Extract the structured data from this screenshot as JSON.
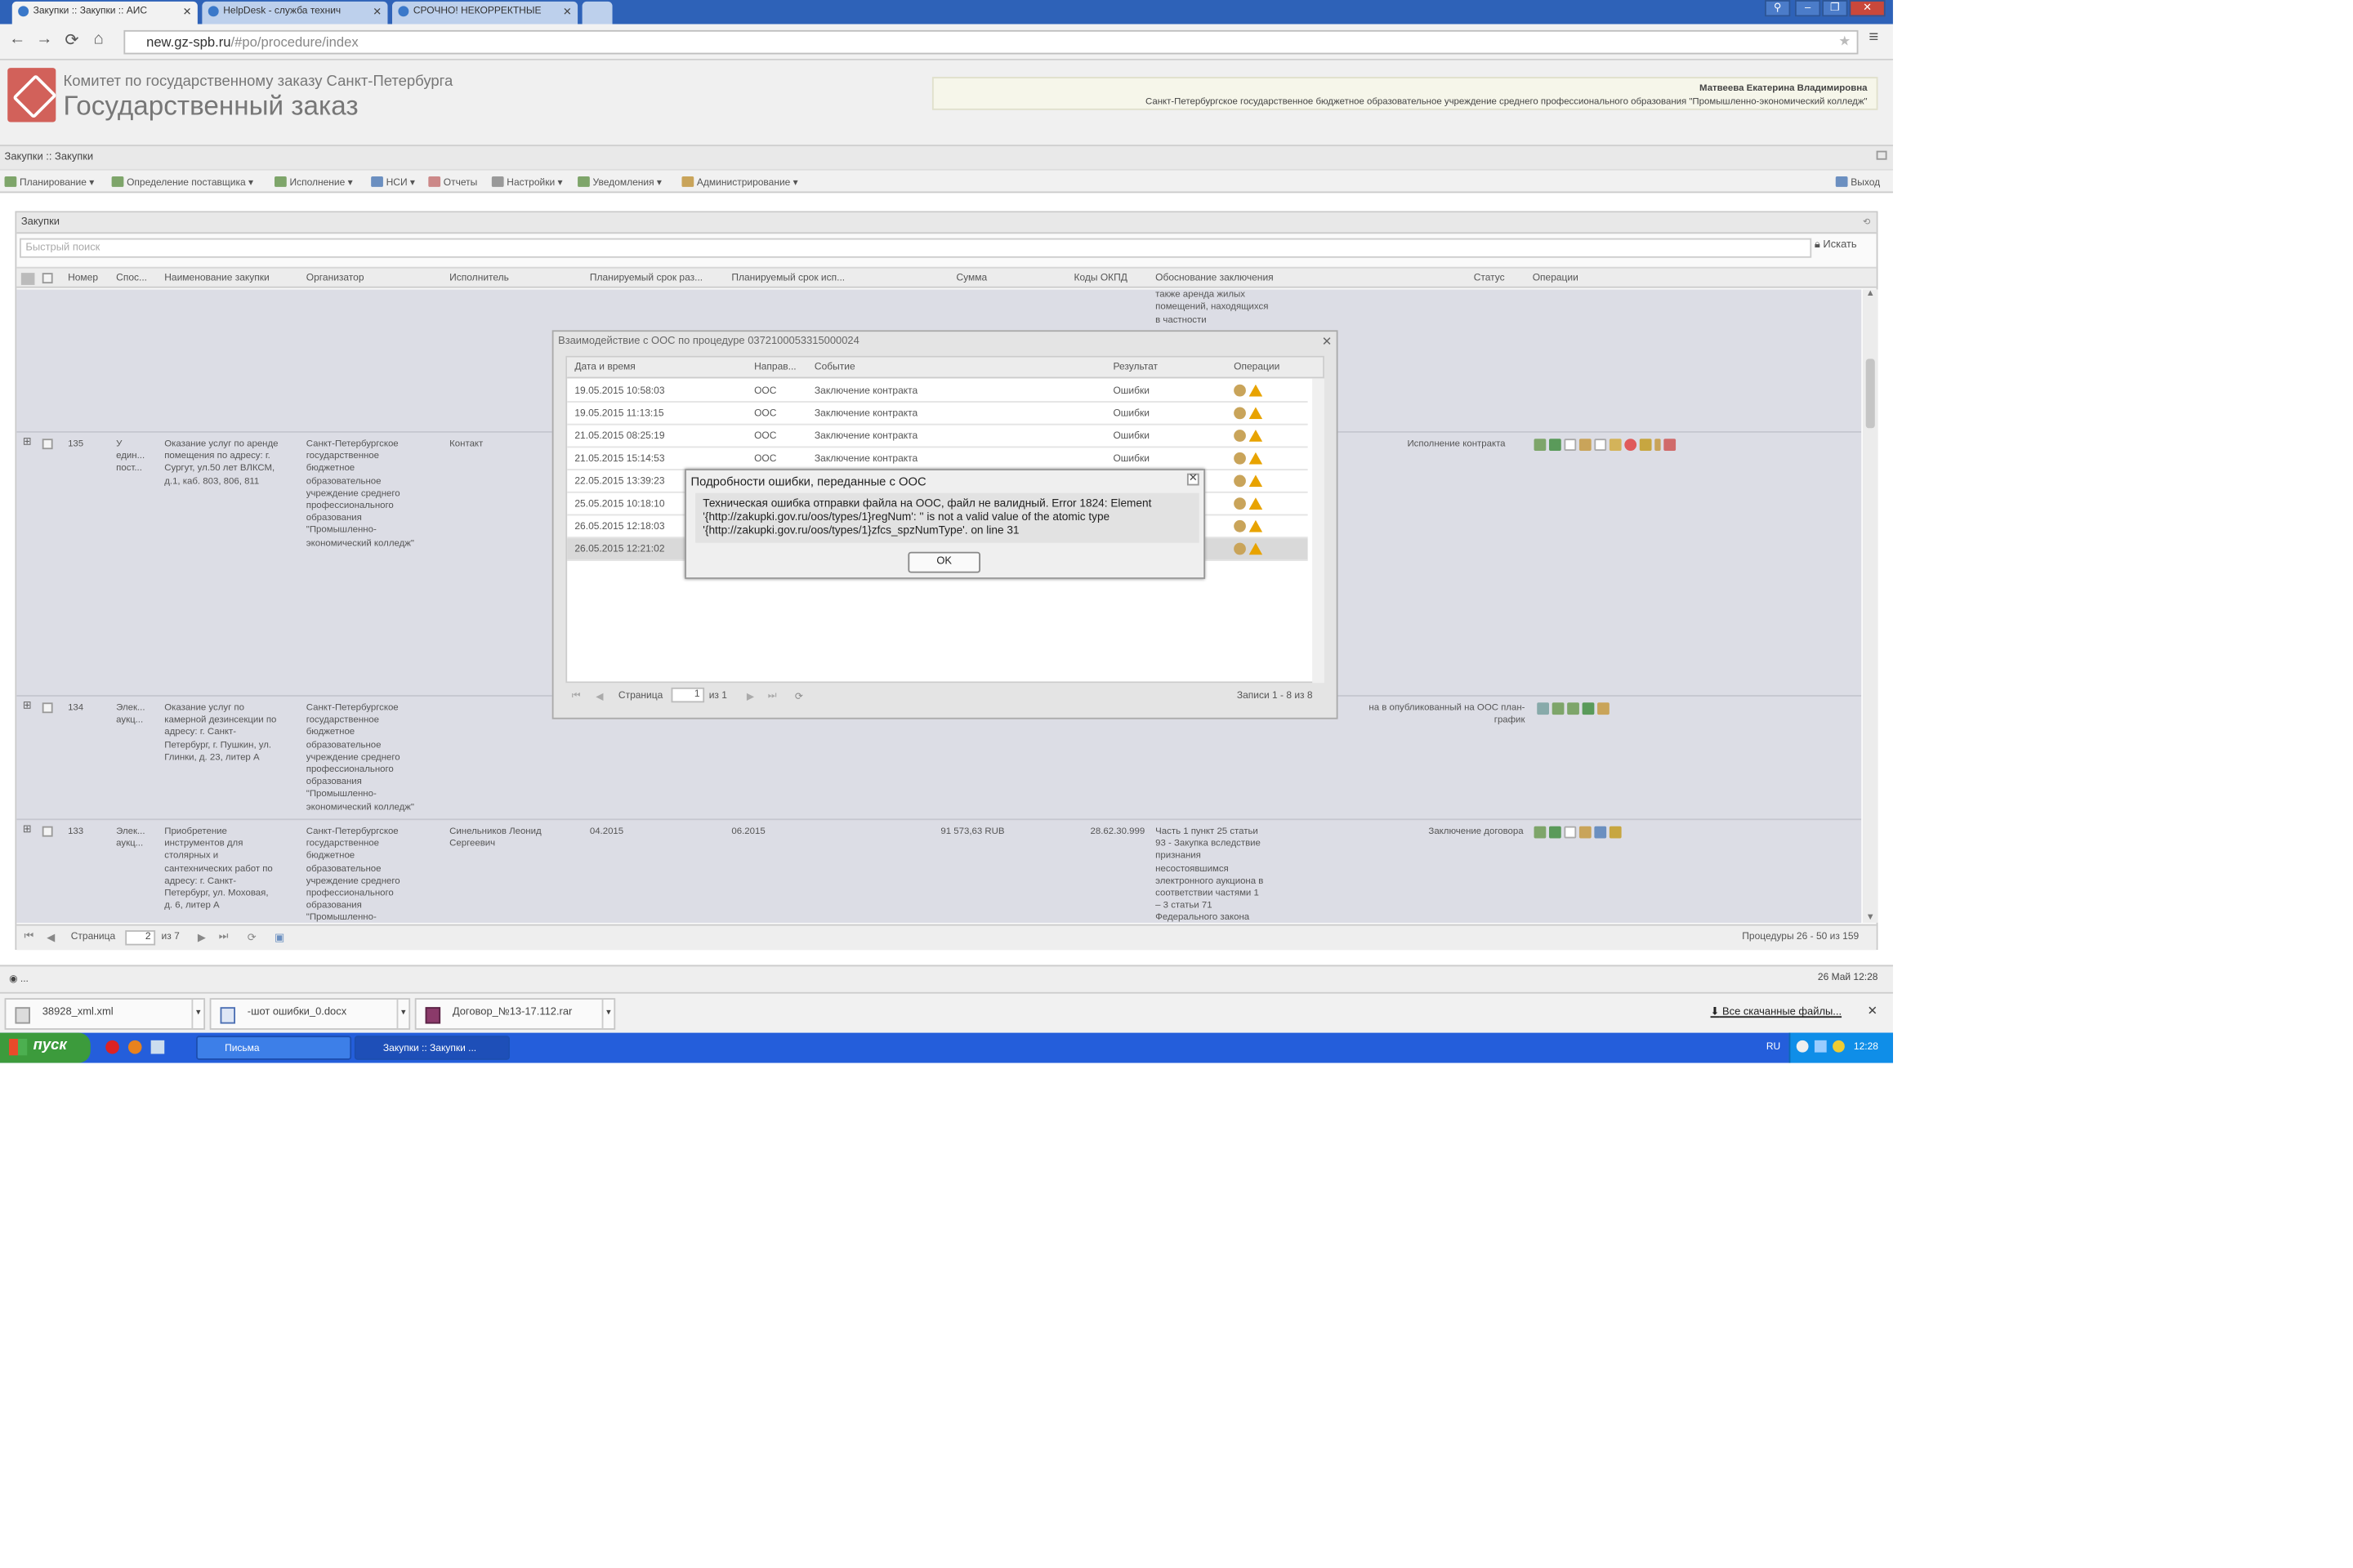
{
  "browser": {
    "tabs": [
      {
        "label": "Закупки :: Закупки :: АИС"
      },
      {
        "label": "HelpDesk - служба технич"
      },
      {
        "label": "СРОЧНО! НЕКОРРЕКТНЫЕ"
      }
    ],
    "url_host": "new.gz-spb.ru",
    "url_path": "/#po/procedure/index"
  },
  "header": {
    "org_line1": "Комитет по государственному заказу Санкт-Петербурга",
    "org_line2": "Государственный заказ",
    "user_name": "Матвеева Екатерина Владимировна",
    "user_org": "Санкт-Петербургское государственное бюджетное образовательное учреждение среднего профессионального образования \"Промышленно-экономический колледж\""
  },
  "breadcrumb": "Закупки :: Закупки",
  "menu": [
    {
      "label": "Планирование ▾"
    },
    {
      "label": "Определение поставщика ▾"
    },
    {
      "label": "Исполнение ▾"
    },
    {
      "label": "НСИ ▾"
    },
    {
      "label": "Отчеты"
    },
    {
      "label": "Настройки ▾"
    },
    {
      "label": "Уведомления ▾"
    },
    {
      "label": "Администрирование ▾"
    }
  ],
  "logout": "Выход",
  "panel": {
    "title": "Закупки",
    "search_placeholder": "Быстрый поиск",
    "search_button": "Искать"
  },
  "columns": [
    "Номер",
    "Спос...",
    "Наименование закупки",
    "Организатор",
    "Исполнитель",
    "Планируемый срок раз...",
    "Планируемый срок исп...",
    "Сумма",
    "Коды ОКПД",
    "Обоснование заключения",
    "Статус",
    "Операции"
  ],
  "rows": [
    {
      "num": "",
      "method": "",
      "name": "",
      "org": "",
      "exec": "",
      "p1": "",
      "p2": "",
      "sum": "",
      "okpd": "",
      "basis": "муниципальных нужд, а\nтакже аренда жилых\nпомещений, находящихся\nв частности",
      "status": ""
    },
    {
      "num": "135",
      "method": "У\nедин...\nпост...",
      "name": "Оказание услуг по аренде\nпомещения по адресу: г.\nСургут, ул.50 лет ВЛКСМ,\nд.1, каб. 803, 806, 811",
      "org": "Санкт-Петербургское\nгосударственное\nбюджетное\nобразовательное\nучреждение среднего\nпрофессионального\nобразования\n\"Промышленно-\nэкономический колледж\"",
      "exec": "Контакт",
      "p1": "",
      "p2": "",
      "sum": "",
      "okpd": "",
      "basis": "",
      "status": "Исполнение контракта"
    },
    {
      "num": "134",
      "method": "Элек...\nаукц...",
      "name": "Оказание услуг по\nкамерной дезинсекции по\nадресу: г. Санкт-\nПетербург, г. Пушкин, ул.\nГлинки, д. 23, литер А",
      "org": "Санкт-Петербургское\nгосударственное\nбюджетное\nобразовательное\nучреждение среднего\nпрофессионального\nобразования\n\"Промышленно-\nэкономический колледж\"",
      "exec": "",
      "p1": "",
      "p2": "",
      "sum": "",
      "okpd": "",
      "basis": "",
      "status": "на в опубликованный на ООС план-\nграфик"
    },
    {
      "num": "133",
      "method": "Элек...\nаукц...",
      "name": "Приобретение\nинструментов для\nстолярных и\nсантехнических работ по\nадресу: г. Санкт-\nПетербург, ул. Моховая,\nд. 6, литер А",
      "org": "Санкт-Петербургское\nгосударственное\nбюджетное\nобразовательное\nучреждение среднего\nпрофессионального\nобразования\n\"Промышленно-",
      "exec": "Синельников Леонид\nСергеевич",
      "p1": "04.2015",
      "p2": "06.2015",
      "sum": "91 573,63 RUB",
      "okpd": "28.62.30.999",
      "basis": "Часть 1 пункт 25 статьи\n93 - Закупка вследствие\nпризнания\nнесостоявшимся\nэлектронного аукциона в\nсоответствии частями 1\n– 3 статьи 71\nФедерального закона",
      "status": "Заключение договора"
    }
  ],
  "pager": {
    "label": "Страница",
    "page": "2",
    "of": "из 7",
    "summary": "Процедуры 26 - 50 из 159"
  },
  "status_bar": {
    "left": "◉ ...",
    "right": "26 Май 12:28"
  },
  "interaction_dialog": {
    "title": "Взаимодействие с ООС по процедуре 0372100053315000024",
    "columns": [
      "Дата и время",
      "Направ...",
      "Событие",
      "Результат",
      "Операции"
    ],
    "rows": [
      {
        "dt": "19.05.2015 10:58:03",
        "dir": "ООС",
        "event": "Заключение контракта",
        "result": "Ошибки"
      },
      {
        "dt": "19.05.2015 11:13:15",
        "dir": "ООС",
        "event": "Заключение контракта",
        "result": "Ошибки"
      },
      {
        "dt": "21.05.2015 08:25:19",
        "dir": "ООС",
        "event": "Заключение контракта",
        "result": "Ошибки"
      },
      {
        "dt": "21.05.2015 15:14:53",
        "dir": "ООС",
        "event": "Заключение контракта",
        "result": "Ошибки"
      },
      {
        "dt": "22.05.2015 13:39:23",
        "dir": "",
        "event": "",
        "result": ""
      },
      {
        "dt": "25.05.2015 10:18:10",
        "dir": "",
        "event": "",
        "result": ""
      },
      {
        "dt": "26.05.2015 12:18:03",
        "dir": "",
        "event": "",
        "result": ""
      },
      {
        "dt": "26.05.2015 12:21:02",
        "dir": "",
        "event": "",
        "result": ""
      }
    ],
    "pager_label": "Страница",
    "pager_page": "1",
    "pager_of": "из 1",
    "records": "Записи 1 - 8 из 8"
  },
  "error_dialog": {
    "title": "Подробности ошибки, переданные с ООС",
    "message": "Техническая ошибка отправки файла на ООС, файл не валидный. Error 1824: Element '{http://zakupki.gov.ru/oos/types/1}regNum': '' is not a valid value of the atomic type '{http://zakupki.gov.ru/oos/types/1}zfcs_spzNumType'. on line 31",
    "ok": "OK"
  },
  "downloads": {
    "items": [
      "38928_xml.xml",
      "-шот ошибки_0.docx",
      "Договор_№13-17.112.rar"
    ],
    "all": "Все скачанные файлы..."
  },
  "taskbar": {
    "start": "пуск",
    "windows": [
      "Письма",
      "Закупки :: Закупки ..."
    ],
    "lang": "RU",
    "clock": "12:28"
  }
}
